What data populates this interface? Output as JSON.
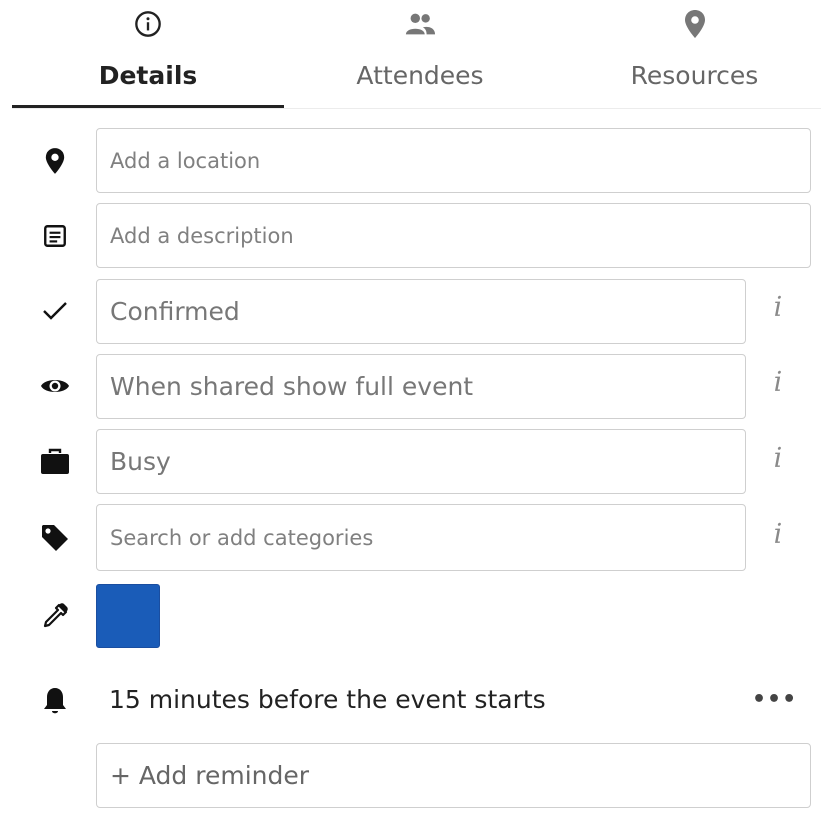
{
  "tabs": [
    {
      "label": "Details",
      "icon": "info-circle-icon",
      "active": true
    },
    {
      "label": "Attendees",
      "icon": "people-icon",
      "active": false
    },
    {
      "label": "Resources",
      "icon": "location-pin-icon",
      "active": false
    }
  ],
  "fields": {
    "location": {
      "placeholder": "Add a location",
      "icon": "location-pin-icon"
    },
    "description": {
      "placeholder": "Add a description",
      "icon": "notes-icon"
    },
    "status": {
      "value": "Confirmed",
      "icon": "checkmark-icon"
    },
    "visibility": {
      "value": "When shared show full event",
      "icon": "eye-icon"
    },
    "availability": {
      "value": "Busy",
      "icon": "briefcase-icon"
    },
    "categories": {
      "placeholder": "Search or add categories",
      "icon": "tag-icon"
    }
  },
  "info_label": "i",
  "color": {
    "icon": "eyedropper-icon",
    "value": "#1a5cb8"
  },
  "reminder": {
    "icon": "bell-icon",
    "text": "15 minutes before the event starts",
    "more_label": "•••"
  },
  "add_reminder": {
    "label": "+ Add reminder"
  }
}
